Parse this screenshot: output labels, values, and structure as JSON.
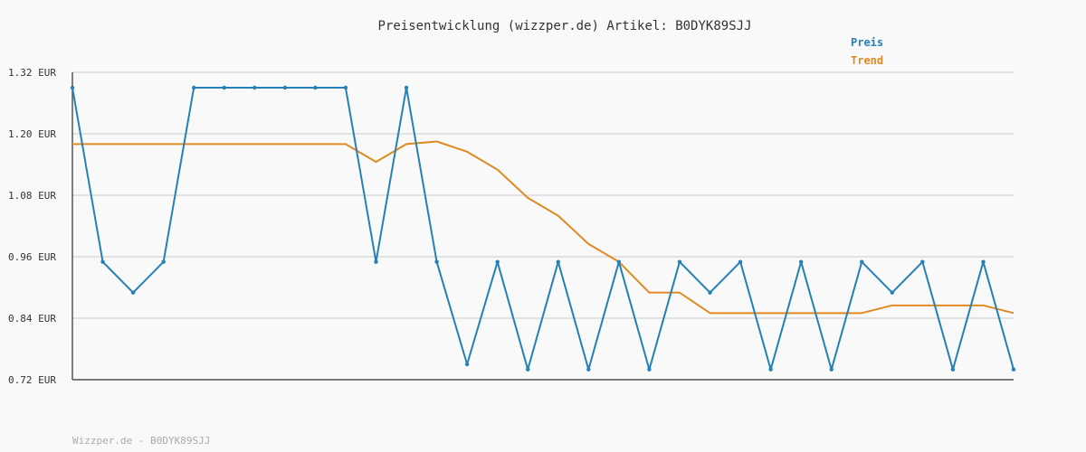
{
  "chart_data": {
    "type": "line",
    "title": "Preisentwicklung (wizzper.de) Artikel: B0DYK89SJJ",
    "xlabel": "",
    "ylabel": "",
    "ylim": [
      0.72,
      1.32
    ],
    "yticks": [
      "1.32 EUR",
      "1.20 EUR",
      "1.08 EUR",
      "0.96 EUR",
      "0.84 EUR",
      "0.72 EUR"
    ],
    "ytick_values": [
      1.32,
      1.2,
      1.08,
      0.96,
      0.84,
      0.72
    ],
    "grid": true,
    "legend_position": "top-right",
    "x": [
      0,
      1,
      2,
      3,
      4,
      5,
      6,
      7,
      8,
      9,
      10,
      11,
      12,
      13,
      14,
      15,
      16,
      17,
      18,
      19,
      20,
      21,
      22,
      23,
      24,
      25,
      26,
      27,
      28,
      29,
      30,
      31
    ],
    "series": [
      {
        "name": "Preis",
        "color": "#2580b8",
        "markers": true,
        "values": [
          1.29,
          0.95,
          0.89,
          0.95,
          1.29,
          1.29,
          1.29,
          1.29,
          1.29,
          1.29,
          0.95,
          1.29,
          0.95,
          0.75,
          0.95,
          0.74,
          0.95,
          0.74,
          0.95,
          0.74,
          0.95,
          0.89,
          0.95,
          0.74,
          0.95,
          0.74,
          0.95,
          0.89,
          0.95,
          0.74,
          0.95,
          0.74
        ]
      },
      {
        "name": "Trend",
        "color": "#e08a22",
        "markers": false,
        "values": [
          1.18,
          1.18,
          1.18,
          1.18,
          1.18,
          1.18,
          1.18,
          1.18,
          1.18,
          1.18,
          1.145,
          1.18,
          1.185,
          1.165,
          1.13,
          1.075,
          1.04,
          0.985,
          0.95,
          0.89,
          0.89,
          0.85,
          0.85,
          0.85,
          0.85,
          0.85,
          0.85,
          0.865,
          0.865,
          0.865,
          0.865,
          0.85
        ]
      }
    ],
    "footer": "Wizzper.de - B0DYK89SJJ"
  }
}
